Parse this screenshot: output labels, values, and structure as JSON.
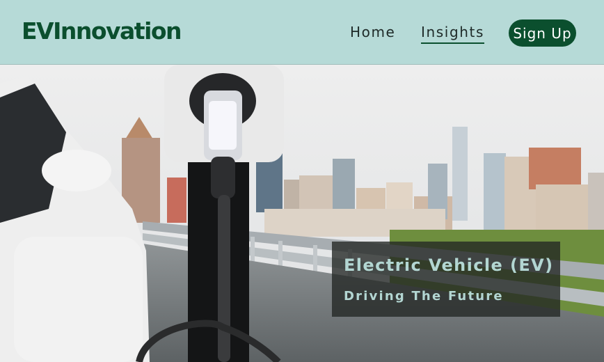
{
  "navbar": {
    "logo": "EVInnovation",
    "links": [
      {
        "label": "Home",
        "active": false
      },
      {
        "label": "Insights",
        "active": true
      }
    ],
    "signup_label": "Sign Up"
  },
  "hero": {
    "title": "Electric Vehicle (EV)",
    "subtitle": "Driving The Future"
  },
  "colors": {
    "navbar_bg": "#b6dad7",
    "brand": "#0b4f2e",
    "caption_text": "#b3d6d2"
  }
}
